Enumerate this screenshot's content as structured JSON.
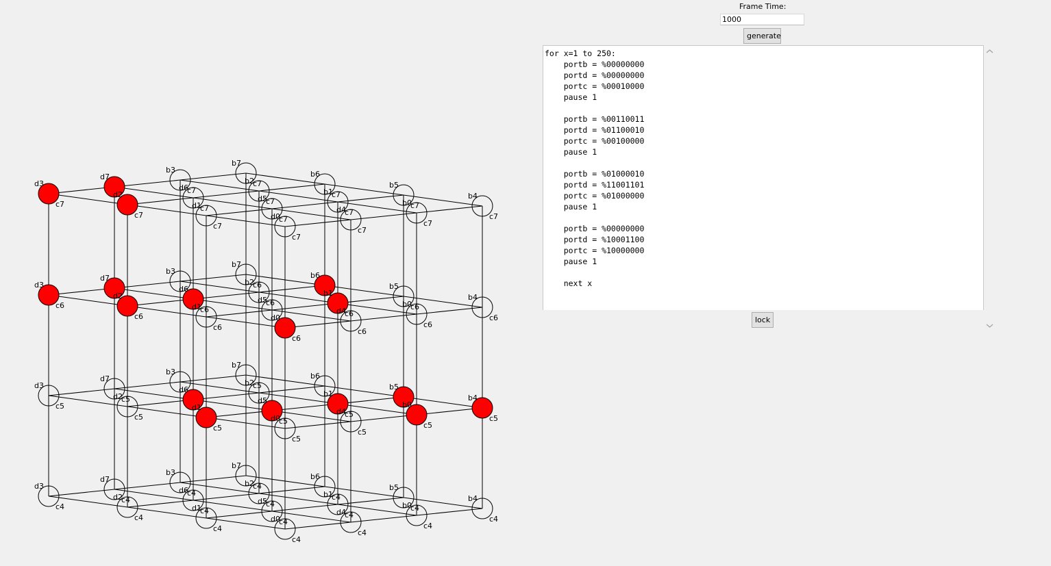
{
  "frame_time": {
    "label": "Frame Time:",
    "value": "1000"
  },
  "buttons": {
    "generate": "generate",
    "lock": "lock"
  },
  "code": "for x=1 to 250:\n    portb = %00000000\n    portd = %00000000\n    portc = %00010000\n    pause 1\n\n    portb = %00110011\n    portd = %01100010\n    portc = %00100000\n    pause 1\n\n    portb = %01000010\n    portd = %11001101\n    portc = %01000000\n    pause 1\n\n    portb = %00000000\n    portd = %10001100\n    portc = %10000000\n    pause 1\n\n    next x",
  "colors": {
    "led_on": "#ff0000",
    "led_off": "#ffffff",
    "background": "#f0f0f0"
  },
  "cube": {
    "columns": [
      {
        "label": "d3",
        "row": 0,
        "col": 0
      },
      {
        "label": "d7",
        "row": 0,
        "col": 1
      },
      {
        "label": "b3",
        "row": 0,
        "col": 2
      },
      {
        "label": "b7",
        "row": 0,
        "col": 3
      },
      {
        "label": "d2",
        "row": 1,
        "col": 0
      },
      {
        "label": "d6",
        "row": 1,
        "col": 1
      },
      {
        "label": "b2",
        "row": 1,
        "col": 2
      },
      {
        "label": "b6",
        "row": 1,
        "col": 3
      },
      {
        "label": "d1",
        "row": 2,
        "col": 0
      },
      {
        "label": "d5",
        "row": 2,
        "col": 1
      },
      {
        "label": "b1",
        "row": 2,
        "col": 2
      },
      {
        "label": "b5",
        "row": 2,
        "col": 3
      },
      {
        "label": "d0",
        "row": 3,
        "col": 0
      },
      {
        "label": "d4",
        "row": 3,
        "col": 1
      },
      {
        "label": "b0",
        "row": 3,
        "col": 2
      },
      {
        "label": "b4",
        "row": 3,
        "col": 3
      }
    ],
    "layers": [
      "c7",
      "c6",
      "c5",
      "c4"
    ],
    "lit": {
      "c7": [
        "d3",
        "d7",
        "d2"
      ],
      "c6": [
        "d3",
        "d7",
        "d2",
        "d6",
        "b6",
        "b1",
        "d0"
      ],
      "c5": [
        "d6",
        "d1",
        "d5",
        "b1",
        "b5",
        "b0",
        "b4"
      ],
      "c4": []
    }
  }
}
